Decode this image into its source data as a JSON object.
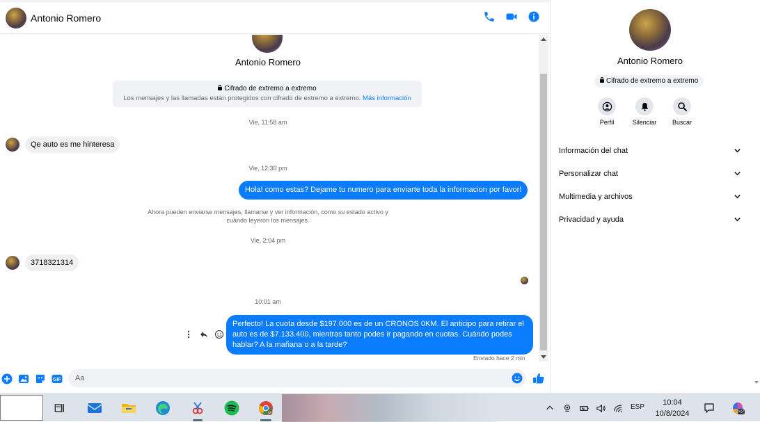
{
  "chat": {
    "contact_name": "Antonio Romero",
    "header": {
      "call": "phone-icon",
      "video": "video-icon",
      "info": "info-icon"
    },
    "intro_name": "Antonio Romero",
    "encryption": {
      "title": "Cifrado de extremo a extremo",
      "subtitle": "Los mensajes y las llamadas están protegidos con cifrado de extremo a extremo.",
      "link": "Más información"
    },
    "timestamps": [
      "Vie, 11:58 am",
      "Vie, 12:30 pm",
      "Vie, 2:04 pm",
      "10:01 am"
    ],
    "messages": {
      "in1": "Qe auto es me hinteresa",
      "out1": "Hola! como estas? Dejame tu numero para enviarte toda la informacion por favor!",
      "system_note": "Ahora pueden enviarse mensajes, llamarse y ver información, como su estado activo y cuándo leyeron los mensajes.",
      "in2": "3718321314",
      "out2": "Perfecto! La cuota desde $197.000 es de un CRONOS 0KM. El anticipo para retirar el auto es de $7.133.400, mientras tanto podes ir pagando en cuotas. Cuándo podes hablar? A la mañana o a la tarde?"
    },
    "sent_status": "Enviado hace 2 min",
    "composer": {
      "placeholder": "Aa"
    }
  },
  "panel": {
    "name": "Antonio Romero",
    "badge": "Cifrado de extremo a extremo",
    "actions": [
      {
        "label": "Perfil",
        "icon": "profile-icon"
      },
      {
        "label": "Silenciar",
        "icon": "bell-icon"
      },
      {
        "label": "Buscar",
        "icon": "search-icon"
      }
    ],
    "sections": [
      "Información del chat",
      "Personalizar chat",
      "Multimedia y archivos",
      "Privacidad y ayuda"
    ]
  },
  "taskbar": {
    "language": "ESP",
    "time": "10:04",
    "date": "10/8/2024"
  },
  "colors": {
    "accent": "#0a7cff",
    "incoming_bubble": "#f0f0f0",
    "panel_bg": "#ffffff"
  }
}
